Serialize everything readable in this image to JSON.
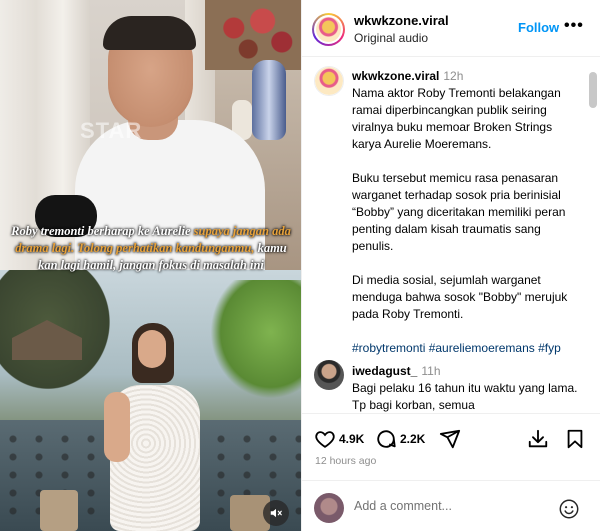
{
  "media": {
    "watermark": "STAR",
    "caption": {
      "part1": "Roby tremonti berharap ke Aurelie ",
      "part2": "supaya jangan ada drama lagi. Tolong perhatikan kandunganmu,",
      "part3": " kamu kan lagi hamil, jangan fokus di masalah ini"
    },
    "mute_icon": "speaker-muted-icon"
  },
  "header": {
    "username": "wkwkzone.viral",
    "audio": "Original audio",
    "follow_label": "Follow",
    "more_label": "•••"
  },
  "caption_post": {
    "username": "wkwkzone.viral",
    "time": "12h",
    "paragraphs": [
      "Nama aktor Roby Tremonti belakangan ramai diperbincangkan publik seiring viralnya buku memoar Broken Strings karya Aurelie Moeremans.",
      "Buku tersebut memicu rasa penasaran warganet terhadap sosok pria berinisial “Bobby” yang diceritakan memiliki peran penting dalam kisah traumatis sang penulis.",
      "Di media sosial, sejumlah warganet menduga bahwa sosok \"Bobby\" merujuk pada Roby Tremonti."
    ],
    "hashtags": "#robytremonti #aureliemoeremans #fyp"
  },
  "comment": {
    "username": "iwedagust_",
    "time": "11h",
    "text": "Bagi pelaku 16 tahun itu waktu yang lama. Tp bagi korban, semua"
  },
  "actions": {
    "likes": "4.9K",
    "comments": "2.2K",
    "icons": [
      "heart-icon",
      "comment-icon",
      "share-icon",
      "download-icon",
      "bookmark-icon"
    ]
  },
  "posted": "12 hours ago",
  "add_comment": {
    "placeholder": "Add a comment..."
  },
  "colors": {
    "link_blue": "#0095f6",
    "hashtag_blue": "#00376b",
    "caption_highlight": "#e8a23a",
    "muted_gray": "#8e8e8e"
  }
}
